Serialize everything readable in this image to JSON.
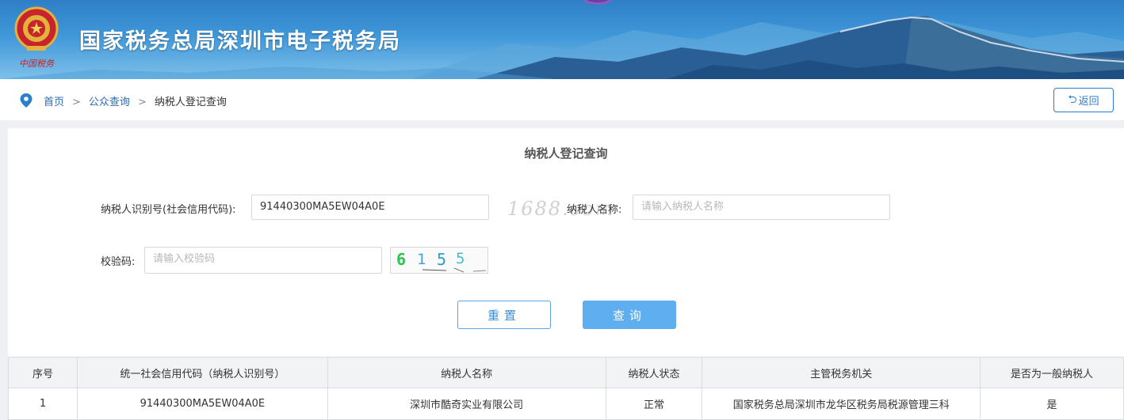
{
  "header": {
    "title": "国家税务总局深圳市电子税务局",
    "emblem_caption": "中国税务"
  },
  "breadcrumb": {
    "home": "首页",
    "separator": ">",
    "public_query": "公众查询",
    "current": "纳税人登记查询"
  },
  "back_button": {
    "icon": "return-icon",
    "label": "返回"
  },
  "form": {
    "title": "纳税人登记查询",
    "taxpayer_id_label": "纳税人识别号(社会信用代码):",
    "taxpayer_id_value": "91440300MA5EW04A0E",
    "taxpayer_name_label": "纳税人名称:",
    "taxpayer_name_placeholder": "请输入纳税人名称",
    "captcha_label": "校验码:",
    "captcha_placeholder": "请输入校验码",
    "captcha_text": "6155",
    "reset_label": "重置",
    "query_label": "查询"
  },
  "watermark": "1688.com",
  "table": {
    "columns": [
      "序号",
      "统一社会信用代码（纳税人识别号）",
      "纳税人名称",
      "纳税人状态",
      "主管税务机关",
      "是否为一般纳税人"
    ],
    "rows": [
      [
        "1",
        "91440300MA5EW04A0E",
        "深圳市酷奇实业有限公司",
        "正常",
        "国家税务总局深圳市龙华区税务局税源管理三科",
        "是"
      ]
    ]
  },
  "colors": {
    "header_blue": "#3f97d8",
    "link_blue": "#2b6cb0",
    "button_blue": "#5eaef0"
  }
}
